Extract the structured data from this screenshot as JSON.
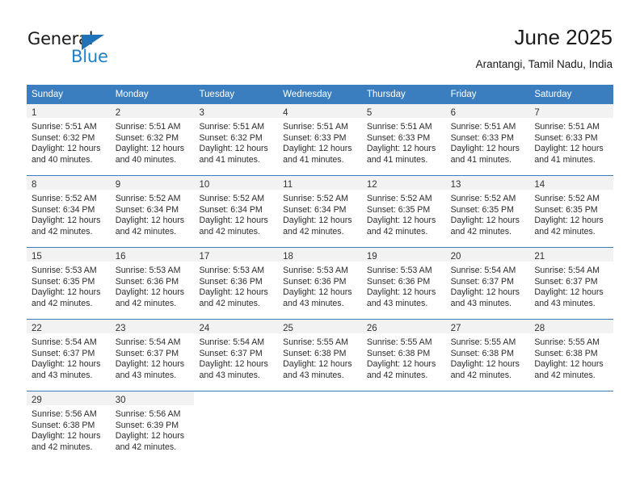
{
  "brand": {
    "name_top": "General",
    "name_bottom": "Blue",
    "accent_color": "#2081c6",
    "triangle_color": "#1f72b8"
  },
  "header": {
    "title": "June 2025",
    "subtitle": "Arantangi, Tamil Nadu, India"
  },
  "calendar": {
    "header_bg": "#3a7ebf",
    "header_text_color": "#ffffff",
    "daynum_band_bg": "#f2f2f2",
    "weekdays": [
      "Sunday",
      "Monday",
      "Tuesday",
      "Wednesday",
      "Thursday",
      "Friday",
      "Saturday"
    ],
    "weeks": [
      [
        {
          "day": "1",
          "sunrise": "Sunrise: 5:51 AM",
          "sunset": "Sunset: 6:32 PM",
          "daylight_1": "Daylight: 12 hours",
          "daylight_2": "and 40 minutes."
        },
        {
          "day": "2",
          "sunrise": "Sunrise: 5:51 AM",
          "sunset": "Sunset: 6:32 PM",
          "daylight_1": "Daylight: 12 hours",
          "daylight_2": "and 40 minutes."
        },
        {
          "day": "3",
          "sunrise": "Sunrise: 5:51 AM",
          "sunset": "Sunset: 6:32 PM",
          "daylight_1": "Daylight: 12 hours",
          "daylight_2": "and 41 minutes."
        },
        {
          "day": "4",
          "sunrise": "Sunrise: 5:51 AM",
          "sunset": "Sunset: 6:33 PM",
          "daylight_1": "Daylight: 12 hours",
          "daylight_2": "and 41 minutes."
        },
        {
          "day": "5",
          "sunrise": "Sunrise: 5:51 AM",
          "sunset": "Sunset: 6:33 PM",
          "daylight_1": "Daylight: 12 hours",
          "daylight_2": "and 41 minutes."
        },
        {
          "day": "6",
          "sunrise": "Sunrise: 5:51 AM",
          "sunset": "Sunset: 6:33 PM",
          "daylight_1": "Daylight: 12 hours",
          "daylight_2": "and 41 minutes."
        },
        {
          "day": "7",
          "sunrise": "Sunrise: 5:51 AM",
          "sunset": "Sunset: 6:33 PM",
          "daylight_1": "Daylight: 12 hours",
          "daylight_2": "and 41 minutes."
        }
      ],
      [
        {
          "day": "8",
          "sunrise": "Sunrise: 5:52 AM",
          "sunset": "Sunset: 6:34 PM",
          "daylight_1": "Daylight: 12 hours",
          "daylight_2": "and 42 minutes."
        },
        {
          "day": "9",
          "sunrise": "Sunrise: 5:52 AM",
          "sunset": "Sunset: 6:34 PM",
          "daylight_1": "Daylight: 12 hours",
          "daylight_2": "and 42 minutes."
        },
        {
          "day": "10",
          "sunrise": "Sunrise: 5:52 AM",
          "sunset": "Sunset: 6:34 PM",
          "daylight_1": "Daylight: 12 hours",
          "daylight_2": "and 42 minutes."
        },
        {
          "day": "11",
          "sunrise": "Sunrise: 5:52 AM",
          "sunset": "Sunset: 6:34 PM",
          "daylight_1": "Daylight: 12 hours",
          "daylight_2": "and 42 minutes."
        },
        {
          "day": "12",
          "sunrise": "Sunrise: 5:52 AM",
          "sunset": "Sunset: 6:35 PM",
          "daylight_1": "Daylight: 12 hours",
          "daylight_2": "and 42 minutes."
        },
        {
          "day": "13",
          "sunrise": "Sunrise: 5:52 AM",
          "sunset": "Sunset: 6:35 PM",
          "daylight_1": "Daylight: 12 hours",
          "daylight_2": "and 42 minutes."
        },
        {
          "day": "14",
          "sunrise": "Sunrise: 5:52 AM",
          "sunset": "Sunset: 6:35 PM",
          "daylight_1": "Daylight: 12 hours",
          "daylight_2": "and 42 minutes."
        }
      ],
      [
        {
          "day": "15",
          "sunrise": "Sunrise: 5:53 AM",
          "sunset": "Sunset: 6:35 PM",
          "daylight_1": "Daylight: 12 hours",
          "daylight_2": "and 42 minutes."
        },
        {
          "day": "16",
          "sunrise": "Sunrise: 5:53 AM",
          "sunset": "Sunset: 6:36 PM",
          "daylight_1": "Daylight: 12 hours",
          "daylight_2": "and 42 minutes."
        },
        {
          "day": "17",
          "sunrise": "Sunrise: 5:53 AM",
          "sunset": "Sunset: 6:36 PM",
          "daylight_1": "Daylight: 12 hours",
          "daylight_2": "and 42 minutes."
        },
        {
          "day": "18",
          "sunrise": "Sunrise: 5:53 AM",
          "sunset": "Sunset: 6:36 PM",
          "daylight_1": "Daylight: 12 hours",
          "daylight_2": "and 43 minutes."
        },
        {
          "day": "19",
          "sunrise": "Sunrise: 5:53 AM",
          "sunset": "Sunset: 6:36 PM",
          "daylight_1": "Daylight: 12 hours",
          "daylight_2": "and 43 minutes."
        },
        {
          "day": "20",
          "sunrise": "Sunrise: 5:54 AM",
          "sunset": "Sunset: 6:37 PM",
          "daylight_1": "Daylight: 12 hours",
          "daylight_2": "and 43 minutes."
        },
        {
          "day": "21",
          "sunrise": "Sunrise: 5:54 AM",
          "sunset": "Sunset: 6:37 PM",
          "daylight_1": "Daylight: 12 hours",
          "daylight_2": "and 43 minutes."
        }
      ],
      [
        {
          "day": "22",
          "sunrise": "Sunrise: 5:54 AM",
          "sunset": "Sunset: 6:37 PM",
          "daylight_1": "Daylight: 12 hours",
          "daylight_2": "and 43 minutes."
        },
        {
          "day": "23",
          "sunrise": "Sunrise: 5:54 AM",
          "sunset": "Sunset: 6:37 PM",
          "daylight_1": "Daylight: 12 hours",
          "daylight_2": "and 43 minutes."
        },
        {
          "day": "24",
          "sunrise": "Sunrise: 5:54 AM",
          "sunset": "Sunset: 6:37 PM",
          "daylight_1": "Daylight: 12 hours",
          "daylight_2": "and 43 minutes."
        },
        {
          "day": "25",
          "sunrise": "Sunrise: 5:55 AM",
          "sunset": "Sunset: 6:38 PM",
          "daylight_1": "Daylight: 12 hours",
          "daylight_2": "and 43 minutes."
        },
        {
          "day": "26",
          "sunrise": "Sunrise: 5:55 AM",
          "sunset": "Sunset: 6:38 PM",
          "daylight_1": "Daylight: 12 hours",
          "daylight_2": "and 42 minutes."
        },
        {
          "day": "27",
          "sunrise": "Sunrise: 5:55 AM",
          "sunset": "Sunset: 6:38 PM",
          "daylight_1": "Daylight: 12 hours",
          "daylight_2": "and 42 minutes."
        },
        {
          "day": "28",
          "sunrise": "Sunrise: 5:55 AM",
          "sunset": "Sunset: 6:38 PM",
          "daylight_1": "Daylight: 12 hours",
          "daylight_2": "and 42 minutes."
        }
      ],
      [
        {
          "day": "29",
          "sunrise": "Sunrise: 5:56 AM",
          "sunset": "Sunset: 6:38 PM",
          "daylight_1": "Daylight: 12 hours",
          "daylight_2": "and 42 minutes."
        },
        {
          "day": "30",
          "sunrise": "Sunrise: 5:56 AM",
          "sunset": "Sunset: 6:39 PM",
          "daylight_1": "Daylight: 12 hours",
          "daylight_2": "and 42 minutes."
        },
        {
          "day": "",
          "sunrise": "",
          "sunset": "",
          "daylight_1": "",
          "daylight_2": ""
        },
        {
          "day": "",
          "sunrise": "",
          "sunset": "",
          "daylight_1": "",
          "daylight_2": ""
        },
        {
          "day": "",
          "sunrise": "",
          "sunset": "",
          "daylight_1": "",
          "daylight_2": ""
        },
        {
          "day": "",
          "sunrise": "",
          "sunset": "",
          "daylight_1": "",
          "daylight_2": ""
        },
        {
          "day": "",
          "sunrise": "",
          "sunset": "",
          "daylight_1": "",
          "daylight_2": ""
        }
      ]
    ]
  }
}
